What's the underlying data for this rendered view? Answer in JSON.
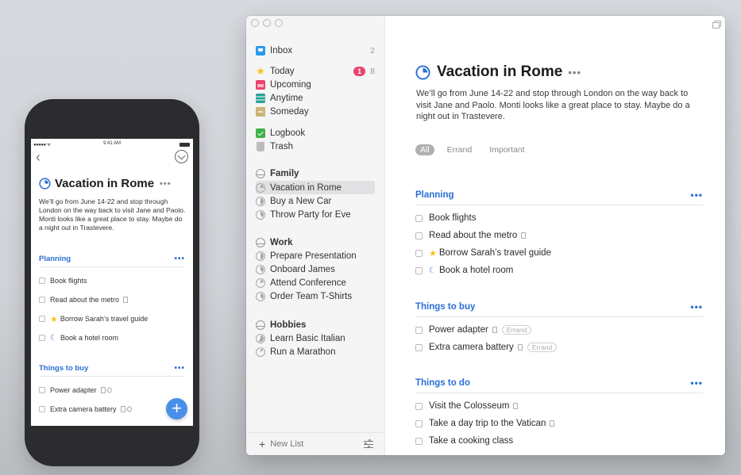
{
  "phone": {
    "status": {
      "signal": "●●●●● ᯤ",
      "time": "9:41 AM"
    },
    "project_title": "Vacation in Rome",
    "notes": "We’ll go from June 14-22 and stop through London on the way back to visit Jane and Paolo. Monti looks like a great place to stay. Maybe do a night out in Trastevere.",
    "sections": [
      {
        "title": "Planning",
        "items": [
          {
            "label": "Book flights",
            "note": false,
            "tag": false,
            "star": false,
            "evening": false
          },
          {
            "label": "Read about the metro",
            "note": true,
            "tag": false,
            "star": false,
            "evening": false
          },
          {
            "label": "Borrow Sarah’s travel guide",
            "note": false,
            "tag": false,
            "star": true,
            "evening": false
          },
          {
            "label": "Book a hotel room",
            "note": false,
            "tag": false,
            "star": false,
            "evening": true
          }
        ]
      },
      {
        "title": "Things to buy",
        "items": [
          {
            "label": "Power adapter",
            "note": true,
            "tag": true
          },
          {
            "label": "Extra camera battery",
            "note": true,
            "tag": true
          }
        ]
      }
    ],
    "fab_label": "+"
  },
  "window": {
    "sidebar": {
      "smart_lists": [
        {
          "label": "Inbox",
          "icon": "inbox-icon",
          "count": "2"
        },
        {
          "label": "Today",
          "icon": "star-icon",
          "badge": "1",
          "count": "8"
        },
        {
          "label": "Upcoming",
          "icon": "calendar-icon"
        },
        {
          "label": "Anytime",
          "icon": "layers-icon"
        },
        {
          "label": "Someday",
          "icon": "archive-box-icon"
        },
        {
          "label": "Logbook",
          "icon": "logbook-icon"
        },
        {
          "label": "Trash",
          "icon": "trash-icon"
        }
      ],
      "areas": [
        {
          "label": "Family",
          "projects": [
            {
              "label": "Vacation in Rome",
              "progress": 0.25,
              "selected": true
            },
            {
              "label": "Buy a New Car",
              "progress": 0.5
            },
            {
              "label": "Throw Party for Eve",
              "progress": 0.4
            }
          ]
        },
        {
          "label": "Work",
          "projects": [
            {
              "label": "Prepare Presentation",
              "progress": 0.5
            },
            {
              "label": "Onboard James",
              "progress": 0.4
            },
            {
              "label": "Attend Conference",
              "progress": 0.2
            },
            {
              "label": "Order Team T-Shirts",
              "progress": 0.4
            }
          ]
        },
        {
          "label": "Hobbies",
          "projects": [
            {
              "label": "Learn Basic Italian",
              "progress": 0.6
            },
            {
              "label": "Run a Marathon",
              "progress": 0.15
            }
          ]
        }
      ],
      "footer": {
        "new_list": "New List"
      }
    },
    "main": {
      "project_title": "Vacation in Rome",
      "notes": "We’ll go from June 14-22 and stop through London on the way back to visit Jane and Paolo. Monti looks like a great place to stay. Maybe do a night out in Trastevere.",
      "tag_filters": [
        {
          "label": "All",
          "active": true
        },
        {
          "label": "Errand",
          "active": false
        },
        {
          "label": "Important",
          "active": false
        }
      ],
      "sections": [
        {
          "title": "Planning",
          "items": [
            {
              "label": "Book flights"
            },
            {
              "label": "Read about the metro",
              "note": true
            },
            {
              "label": "Borrow Sarah’s travel guide",
              "star": true
            },
            {
              "label": "Book a hotel room",
              "evening": true
            }
          ]
        },
        {
          "title": "Things to buy",
          "items": [
            {
              "label": "Power adapter",
              "note": true,
              "tag": "Errand"
            },
            {
              "label": "Extra camera battery",
              "note": true,
              "tag": "Errand"
            }
          ]
        },
        {
          "title": "Things to do",
          "items": [
            {
              "label": "Visit the Colosseum",
              "note": true
            },
            {
              "label": "Take a day trip to the Vatican",
              "note": true
            },
            {
              "label": "Take a cooking class"
            }
          ]
        }
      ]
    },
    "colors": {
      "accent": "#2a6fd6",
      "badge": "#e8446c",
      "star": "#f5c518"
    }
  }
}
